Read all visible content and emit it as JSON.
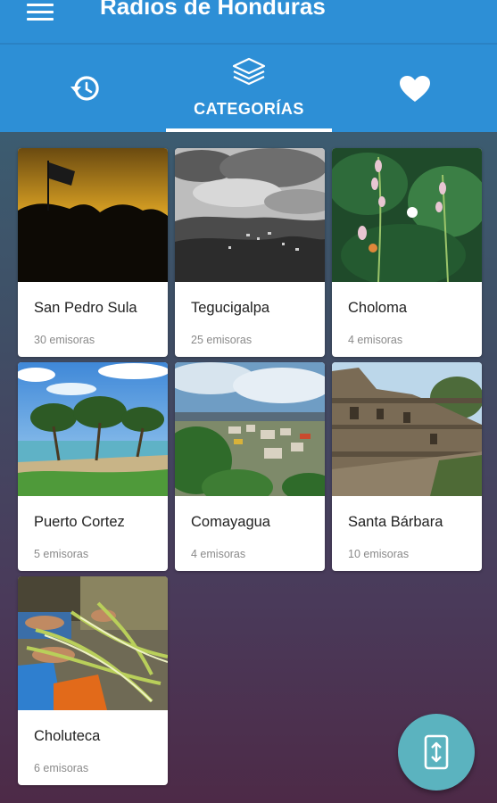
{
  "app": {
    "title": "Radios de Honduras"
  },
  "tabs": {
    "active_label": "CATEGORÍAS",
    "history_icon": "history-icon",
    "categories_icon": "layers-icon",
    "favorites_icon": "heart-icon"
  },
  "colors": {
    "appbar": "#2d8fd6",
    "fab": "#5bb3bf"
  },
  "categories": [
    {
      "name": "San Pedro Sula",
      "count": "30 emisoras"
    },
    {
      "name": "Tegucigalpa",
      "count": "25 emisoras"
    },
    {
      "name": "Choloma",
      "count": "4 emisoras"
    },
    {
      "name": "Puerto Cortez",
      "count": "5 emisoras"
    },
    {
      "name": "Comayagua",
      "count": "4 emisoras"
    },
    {
      "name": "Santa Bárbara",
      "count": "10 emisoras"
    },
    {
      "name": "Choluteca",
      "count": "6 emisoras"
    }
  ],
  "fab": {
    "icon": "phone-rotate-icon"
  }
}
